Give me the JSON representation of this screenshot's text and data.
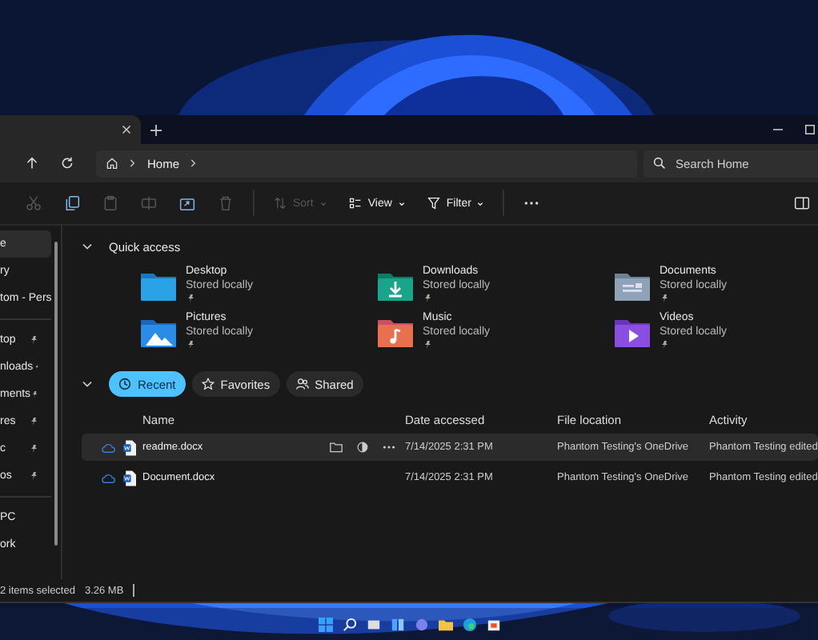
{
  "window": {
    "tabs": [
      {
        "selected": true
      }
    ],
    "address_bar": {
      "path": [
        "Home"
      ]
    },
    "search": {
      "placeholder": "Search Home"
    }
  },
  "toolbar": {
    "cut": {
      "disabled": true
    },
    "copy": {
      "disabled": false
    },
    "paste": {
      "disabled": true
    },
    "rename": {
      "disabled": true
    },
    "share": {
      "disabled": false
    },
    "delete": {
      "disabled": true
    },
    "menus": [
      {
        "kind": "sort",
        "label": "Sort",
        "disabled": true
      },
      {
        "kind": "view",
        "label": "View",
        "disabled": false
      },
      {
        "kind": "filter",
        "label": "Filter",
        "disabled": false
      }
    ]
  },
  "sidebar": {
    "sections": [
      [
        {
          "label": "e",
          "selected": true,
          "pinned": false
        },
        {
          "label": "ry",
          "selected": false,
          "pinned": false
        },
        {
          "label": "tom - Pers",
          "selected": false,
          "pinned": false
        }
      ],
      [
        {
          "label": "top",
          "selected": false,
          "pinned": true
        },
        {
          "label": "nloads",
          "selected": false,
          "pinned": true
        },
        {
          "label": "ments",
          "selected": false,
          "pinned": true
        },
        {
          "label": "res",
          "selected": false,
          "pinned": true
        },
        {
          "label": "c",
          "selected": false,
          "pinned": true
        },
        {
          "label": "os",
          "selected": false,
          "pinned": true
        }
      ],
      [
        {
          "label": "PC",
          "selected": false,
          "pinned": false
        },
        {
          "label": "ork",
          "selected": false,
          "pinned": false
        }
      ]
    ]
  },
  "quick_access": {
    "title": "Quick access",
    "expanded": true,
    "items": [
      {
        "kind": "desktop",
        "name": "Desktop",
        "status": "Stored locally",
        "pinned": true
      },
      {
        "kind": "downloads",
        "name": "Downloads",
        "status": "Stored locally",
        "pinned": true
      },
      {
        "kind": "documents",
        "name": "Documents",
        "status": "Stored locally",
        "pinned": true
      },
      {
        "kind": "pictures",
        "name": "Pictures",
        "status": "Stored locally",
        "pinned": true
      },
      {
        "kind": "music",
        "name": "Music",
        "status": "Stored locally",
        "pinned": true
      },
      {
        "kind": "videos",
        "name": "Videos",
        "status": "Stored locally",
        "pinned": true
      }
    ]
  },
  "recent": {
    "expanded": true,
    "filters": [
      {
        "kind": "recent",
        "label": "Recent",
        "selected": true
      },
      {
        "kind": "favorites",
        "label": "Favorites",
        "selected": false
      },
      {
        "kind": "shared",
        "label": "Shared",
        "selected": false
      }
    ],
    "columns": [
      "Name",
      "Date accessed",
      "File location",
      "Activity"
    ],
    "rows": [
      {
        "name": "readme.docx",
        "date": "7/14/2025 2:31 PM",
        "location": "Phantom Testing's OneDrive",
        "activity": "Phantom Testing edited",
        "selected": true
      },
      {
        "name": "Document.docx",
        "date": "7/14/2025 2:31 PM",
        "location": "Phantom Testing's OneDrive",
        "activity": "Phantom Testing edited",
        "selected": false
      }
    ]
  },
  "status_bar": {
    "count": "2 items selected",
    "size": "3.26 MB"
  }
}
